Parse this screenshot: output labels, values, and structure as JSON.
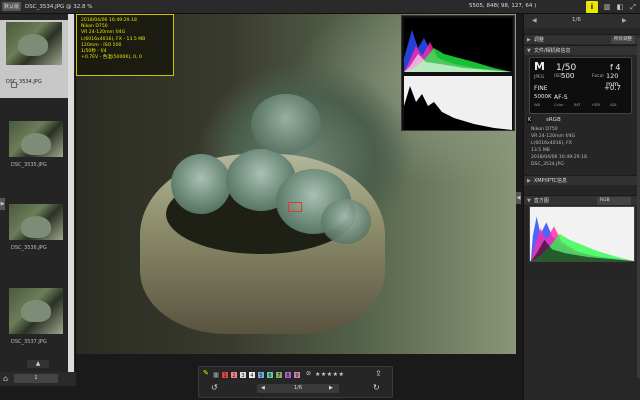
{
  "topbar": {
    "tag": "默认版",
    "title": "DSC_3534.JPG @ 32.8 %",
    "coord": "5505, 848( 98, 127, 64 )",
    "btn_i": "i",
    "btn_b": "i"
  },
  "filmstrip": {
    "items": [
      {
        "label": "DSC_3534.JPG"
      },
      {
        "label": "DSC_3535.JPG"
      },
      {
        "label": "DSC_3536.JPG"
      },
      {
        "label": "DSC_3537.JPG"
      }
    ],
    "page": "1",
    "up_arrow": "▲"
  },
  "info_overlay": {
    "lines": [
      "2018/04/06 16:49:29.18",
      "Nikon D750",
      "VR 24-120mm f/4G",
      "L(6016x4016), FX - 13.5 MB",
      "120mm - ISO 500",
      "1/50秒 - f/4",
      "+0.7EV - 色温(5000K), 0, 0"
    ]
  },
  "toolbar": {
    "labels": [
      "1",
      "2",
      "3",
      "4",
      "5",
      "6",
      "7",
      "8",
      "9"
    ],
    "label_colors": [
      "#d44",
      "#e88",
      "#ddd",
      "#eee",
      "#7ad",
      "#6ca",
      "#8a6",
      "#a6c",
      "#c8a"
    ],
    "zero": "0",
    "stars": "★★★★★",
    "counter": "1/6",
    "prev": "◀",
    "next": "▶"
  },
  "panel": {
    "counter": "1/6",
    "sections": {
      "adjust": "调整",
      "adjust_select": "所有调整",
      "file_info": "文件/相机和信息",
      "xmp": "XMP/IPTC信息",
      "histogram": "直方图",
      "histogram_select": "RGB"
    },
    "camera": {
      "mode": "M",
      "shutter": "1/50",
      "aperture": "f 4",
      "iso_label": "ISO",
      "iso": "500",
      "focal_label": "Focal",
      "focal": "120 mm",
      "fmt": "JPEG",
      "quality": "FINE",
      "exp_comp": "+0.7",
      "af": "AF-S",
      "wb": "5000K",
      "colorspace": "sRGB",
      "row_labels": [
        "WB",
        "Color",
        "BKT",
        "HDR",
        "ADL"
      ]
    },
    "meta": [
      "Nikon D750",
      "VR 24-120mm f/4G",
      "L(6016x4016), FX",
      "13.5 MB",
      "2018/04/06 16:49:29.18",
      "DSC_3534.JPG"
    ]
  },
  "colors": {
    "overlay_text": "#e6e800",
    "accent": "#e8e800",
    "focus": "#e03a2a"
  }
}
